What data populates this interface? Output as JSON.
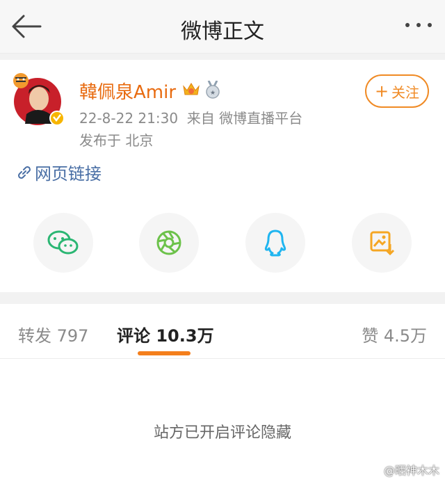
{
  "nav": {
    "title": "微博正文"
  },
  "post": {
    "username": "韓佩泉Amir",
    "time": "22-8-22 21:30",
    "source": "来自 微博直播平台",
    "location": "发布于 北京",
    "follow_label": "关注",
    "link_text": "网页链接"
  },
  "share": [
    "wechat-icon",
    "moments-icon",
    "qq-icon",
    "save-image-icon"
  ],
  "tabs": {
    "repost": "转发 797",
    "comments": "评论 10.3万",
    "likes": "赞 4.5万"
  },
  "notice": "站方已开启评论隐藏",
  "watermark": "@晒神木木",
  "colors": {
    "accent": "#f47f1c",
    "username": "#e86b10",
    "link": "#4a6fa5"
  }
}
